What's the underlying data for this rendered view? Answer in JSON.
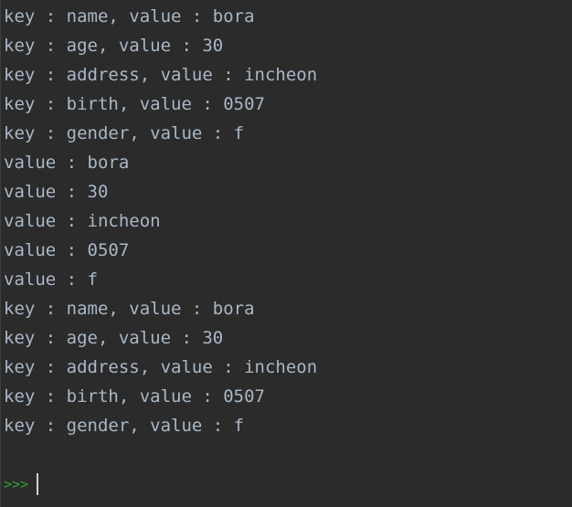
{
  "console": {
    "lines": [
      "key : name, value : bora",
      "key : age, value : 30",
      "key : address, value : incheon",
      "key : birth, value : 0507",
      "key : gender, value : f",
      "value : bora",
      "value : 30",
      "value : incheon",
      "value : 0507",
      "value : f",
      "key : name, value : bora",
      "key : age, value : 30",
      "key : address, value : incheon",
      "key : birth, value : 0507",
      "key : gender, value : f"
    ],
    "prompt": ">>>",
    "input_value": ""
  },
  "colors": {
    "background": "#2b2b2b",
    "text": "#a9b7c6",
    "prompt": "#2fa12f"
  }
}
